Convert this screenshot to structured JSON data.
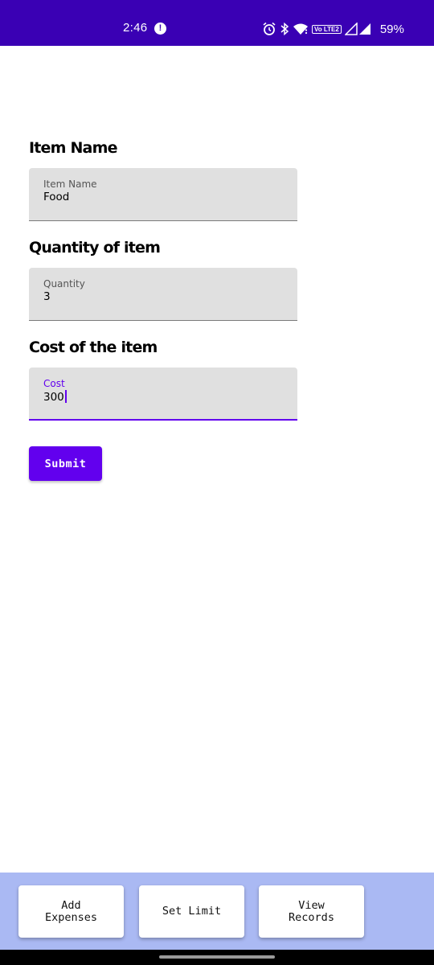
{
  "status_bar": {
    "time": "2:46",
    "alert": "!",
    "network_badge": "Vo LTE2",
    "battery": "59%",
    "bg_color": "#3a00b4"
  },
  "form": {
    "item_name": {
      "title": "Item Name",
      "label": "Item Name",
      "value": "Food"
    },
    "quantity": {
      "title": "Quantity of item",
      "label": "Quantity",
      "value": "3"
    },
    "cost": {
      "title": "Cost of the item",
      "label": "Cost",
      "value": "300"
    },
    "submit_label": "Submit"
  },
  "bottom_nav": {
    "add_expenses": "Add\nExpenses",
    "set_limit": "Set Limit",
    "view_records": "View\nRecords",
    "bg_color": "#aab9f3"
  },
  "colors": {
    "accent": "#6200ee"
  }
}
